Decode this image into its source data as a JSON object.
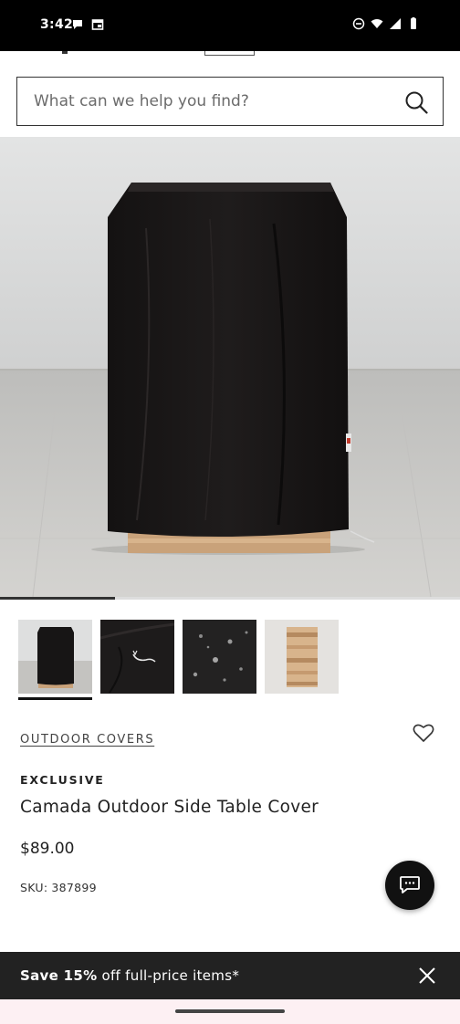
{
  "status_bar": {
    "time": "3:42",
    "left_icons": [
      "chat-notification-icon",
      "calendar-notification-icon"
    ],
    "right_icons": [
      "do-not-disturb-icon",
      "wifi-icon",
      "signal-icon",
      "battery-icon"
    ]
  },
  "search": {
    "placeholder": "What can we help you find?",
    "value": ""
  },
  "gallery": {
    "progress": 0.25,
    "thumbnails": [
      {
        "name": "cover-front-thumb",
        "selected": true
      },
      {
        "name": "cover-drawstring-thumb",
        "selected": false
      },
      {
        "name": "cover-water-droplets-thumb",
        "selected": false
      },
      {
        "name": "side-table-thumb",
        "selected": false
      }
    ]
  },
  "product": {
    "category": "OUTDOOR COVERS",
    "badge": "EXCLUSIVE",
    "title": "Camada Outdoor Side Table Cover",
    "price": "$89.00",
    "sku_label": "SKU:",
    "sku": "387899"
  },
  "promo": {
    "bold": "Save 15%",
    "text": " off full-price items*"
  },
  "colors": {
    "accent": "#111111",
    "promo_bg": "#222222"
  }
}
